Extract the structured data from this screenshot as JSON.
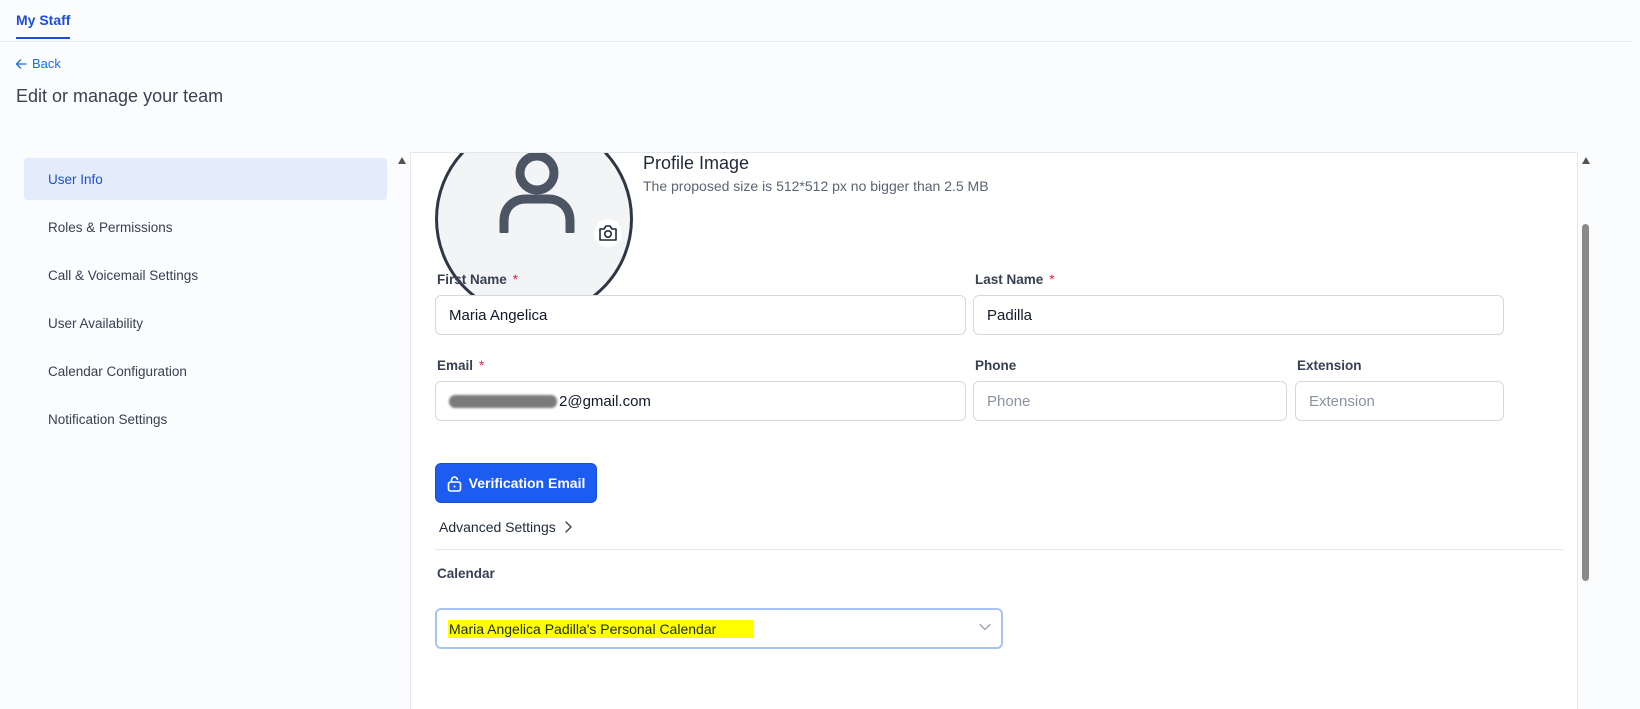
{
  "topnav": {
    "tab_label": "My Staff"
  },
  "header": {
    "back_label": "Back",
    "title": "Edit or manage your team"
  },
  "sidebar": {
    "items": [
      {
        "label": "User Info",
        "active": true
      },
      {
        "label": "Roles & Permissions"
      },
      {
        "label": "Call & Voicemail Settings"
      },
      {
        "label": "User Availability"
      },
      {
        "label": "Calendar Configuration"
      },
      {
        "label": "Notification Settings"
      }
    ]
  },
  "profile": {
    "title": "Profile Image",
    "subtitle": "The proposed size is 512*512 px no bigger than 2.5 MB"
  },
  "form": {
    "first_name": {
      "label": "First Name",
      "required_mark": "*",
      "value": "Maria Angelica"
    },
    "last_name": {
      "label": "Last Name",
      "required_mark": "*",
      "value": "Padilla"
    },
    "email": {
      "label": "Email",
      "required_mark": "*",
      "value_suffix": "2@gmail.com"
    },
    "phone": {
      "label": "Phone",
      "placeholder": "Phone"
    },
    "extension": {
      "label": "Extension",
      "placeholder": "Extension"
    },
    "verify_button": "Verification Email",
    "advanced_settings": "Advanced Settings",
    "calendar": {
      "label": "Calendar",
      "value": "Maria Angelica Padilla's Personal Calendar"
    }
  },
  "colors": {
    "accent": "#1d5cf0",
    "active_bg": "#e4ecfb",
    "required": "#e11d48",
    "highlight": "#ffff00"
  }
}
